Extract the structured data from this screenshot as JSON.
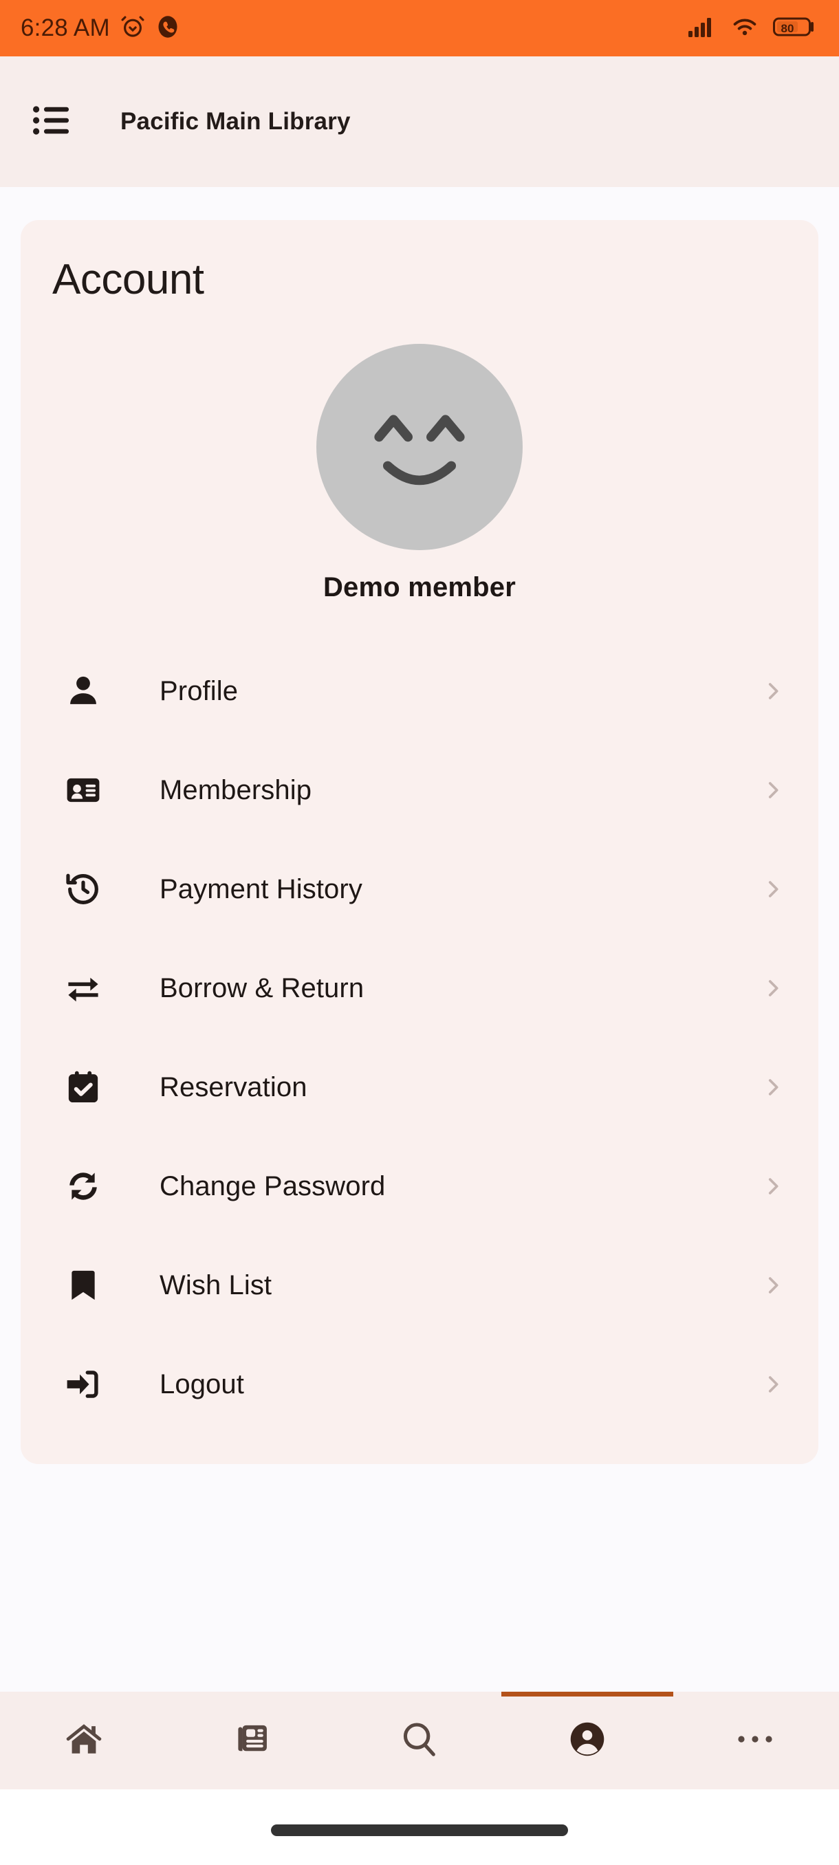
{
  "status_bar": {
    "time": "6:28 AM",
    "alarm_icon": "alarm-clock-icon",
    "call_icon": "phone-call-icon",
    "signal_icon": "cellular-signal-icon",
    "wifi_icon": "wifi-icon",
    "battery_icon": "battery-icon",
    "battery_level": "80",
    "background_color": "#FB6E24",
    "foreground_color": "#4A1B05"
  },
  "app_bar": {
    "menu_icon": "list-menu-icon",
    "title": "Pacific Main Library",
    "background_color": "#F7EDEB"
  },
  "account_card": {
    "title": "Account",
    "background_color": "#FAF0EE",
    "avatar": {
      "icon": "smiley-face-avatar",
      "background_color": "#C4C4C4",
      "stroke_color": "#4A4A4A"
    },
    "member_name": "Demo member",
    "menu_items": [
      {
        "icon": "person-icon",
        "label": "Profile",
        "chevron": "chevron-right-icon"
      },
      {
        "icon": "id-card-icon",
        "label": "Membership",
        "chevron": "chevron-right-icon"
      },
      {
        "icon": "history-clock-icon",
        "label": "Payment History",
        "chevron": "chevron-right-icon"
      },
      {
        "icon": "swap-arrows-icon",
        "label": "Borrow & Return",
        "chevron": "chevron-right-icon"
      },
      {
        "icon": "calendar-check-icon",
        "label": "Reservation",
        "chevron": "chevron-right-icon"
      },
      {
        "icon": "sync-arrows-icon",
        "label": "Change Password",
        "chevron": "chevron-right-icon"
      },
      {
        "icon": "bookmark-icon",
        "label": "Wish List",
        "chevron": "chevron-right-icon"
      },
      {
        "icon": "logout-icon",
        "label": "Logout",
        "chevron": "chevron-right-icon"
      }
    ]
  },
  "bottom_nav": {
    "background_color": "#F7EDEB",
    "active_indicator_color": "#B4521A",
    "icon_color": "#584842",
    "active_icon_color": "#3A251C",
    "items": [
      {
        "icon": "home-icon",
        "name": "home",
        "active": false
      },
      {
        "icon": "newspaper-icon",
        "name": "catalog",
        "active": false
      },
      {
        "icon": "search-icon",
        "name": "search",
        "active": false
      },
      {
        "icon": "account-icon",
        "name": "account",
        "active": true
      },
      {
        "icon": "more-icon",
        "name": "more",
        "active": false
      }
    ]
  },
  "page": {
    "background_color": "#FBFAFD",
    "gesture_bar_color": "#333333"
  }
}
